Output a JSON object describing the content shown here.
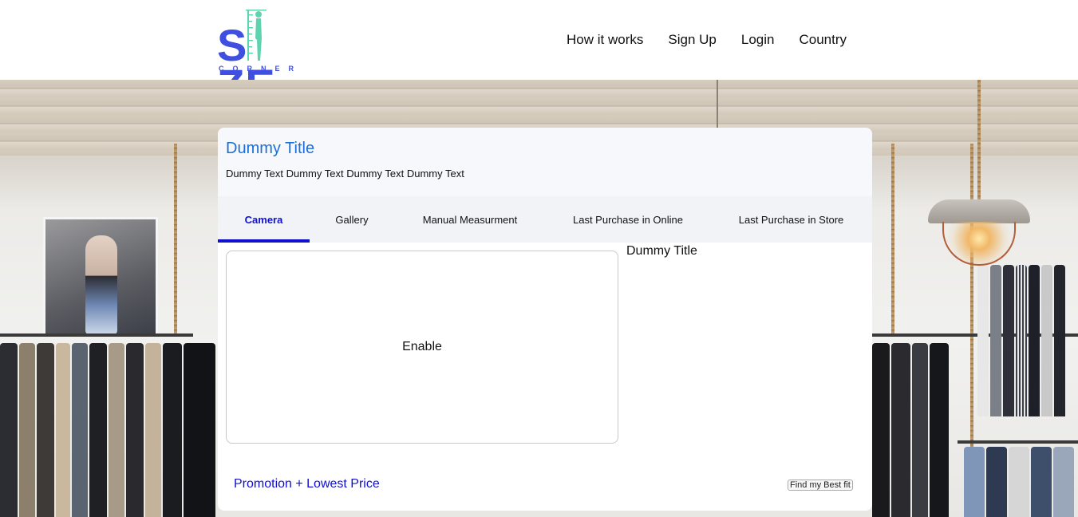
{
  "header": {
    "logo_main_left": "S",
    "logo_main_right": "ZE",
    "logo_sub": "CORNER",
    "nav": [
      "How it works",
      "Sign Up",
      "Login",
      "Country"
    ]
  },
  "card": {
    "title": "Dummy Title",
    "text": "Dummy Text Dummy Text Dummy Text Dummy Text",
    "tabs": [
      {
        "label": "Camera",
        "active": true
      },
      {
        "label": "Gallery",
        "active": false
      },
      {
        "label": "Manual Measurment",
        "active": false
      },
      {
        "label": "Last Purchase in Online",
        "active": false
      },
      {
        "label": "Last Purchase in Store",
        "active": false
      }
    ],
    "camera_enable_label": "Enable",
    "side_title": "Dummy Title",
    "promo": "Promotion + Lowest Price",
    "best_fit_button": "Find my Best fit"
  },
  "colors": {
    "brand_blue": "#3f4fe0",
    "brand_mint": "#5fd3b0",
    "title_blue": "#1a6fd8",
    "active_tab": "#1010d0"
  }
}
